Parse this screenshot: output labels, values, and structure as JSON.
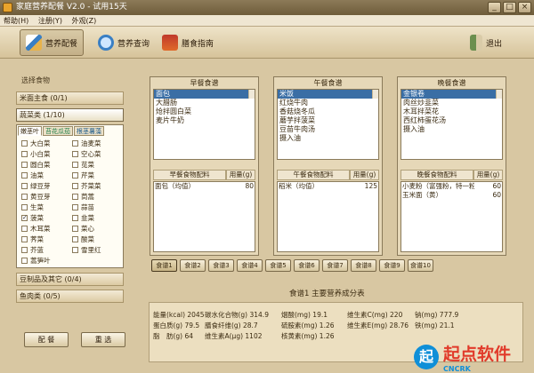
{
  "window": {
    "title": "家庭营养配餐 V2.0 - 试用15天",
    "min": "_",
    "max": "□",
    "close": "×"
  },
  "menu": [
    "帮助(H)",
    "注册(Y)",
    "外观(Z)"
  ],
  "toolbar": {
    "items": [
      "营养配餐",
      "营养查询",
      "膳食指南"
    ],
    "exit": "退出"
  },
  "left": {
    "select_label": "选择食物",
    "categories": [
      "米面主食 (0/1)",
      "蔬菜类 (1/10)",
      "豆制品及其它 (0/4)",
      "鱼肉类 (0/5)"
    ],
    "veg_tabs": [
      "嫩茎叶",
      "苔花瓜茄",
      "根茎薯藻"
    ],
    "veg_left": [
      {
        "name": "大白菜",
        "checked": false
      },
      {
        "name": "小白菜",
        "checked": false
      },
      {
        "name": "圆白菜",
        "checked": false
      },
      {
        "name": "油菜",
        "checked": false
      },
      {
        "name": "绿豆芽",
        "checked": false
      },
      {
        "name": "黄豆芽",
        "checked": false
      },
      {
        "name": "生菜",
        "checked": false
      },
      {
        "name": "菠菜",
        "checked": true
      },
      {
        "name": "木耳菜",
        "checked": false
      },
      {
        "name": "荠菜",
        "checked": false
      },
      {
        "name": "芥蓝",
        "checked": false
      },
      {
        "name": "蒿笋叶",
        "checked": false
      }
    ],
    "veg_right": [
      {
        "name": "油麦菜",
        "checked": false
      },
      {
        "name": "空心菜",
        "checked": false
      },
      {
        "name": "苋菜",
        "checked": false
      },
      {
        "name": "芹菜",
        "checked": false
      },
      {
        "name": "芥菜菜",
        "checked": false
      },
      {
        "name": "茼蒿",
        "checked": false
      },
      {
        "name": "蒜苗",
        "checked": false
      },
      {
        "name": "韭菜",
        "checked": false
      },
      {
        "name": "菜心",
        "checked": false
      },
      {
        "name": "酸菜",
        "checked": false
      },
      {
        "name": "雪里红",
        "checked": false
      }
    ],
    "btn_pei": "配 餐",
    "btn_reselect": "重 选"
  },
  "meals": [
    {
      "title": "早餐食谱",
      "items": [
        "面包",
        "大腊肠",
        "炝拌圆白菜",
        "麦片牛奶"
      ],
      "selected": 0,
      "col_food": "早餐食物配料",
      "col_qty": "用量(g)",
      "rows": [
        [
          "面包（均值）",
          "80"
        ]
      ]
    },
    {
      "title": "午餐食谱",
      "items": [
        "米饭",
        "红烧牛肉",
        "香菇烧冬瓜",
        "蘑芋拌菠菜",
        "豆苗牛肉汤",
        "摄入油"
      ],
      "selected": 0,
      "col_food": "午餐食物配料",
      "col_qty": "用量(g)",
      "rows": [
        [
          "稻米（均值）",
          "125"
        ]
      ]
    },
    {
      "title": "晚餐食谱",
      "items": [
        "金银卷",
        "肉丝炒韭菜",
        "木耳拌菜花",
        "西红柿蛋花汤",
        "摄入油"
      ],
      "selected": 0,
      "col_food": "晚餐食物配料",
      "col_qty": "用量(g)",
      "rows": [
        [
          "小麦粉（富强粉，特一粉）",
          "60"
        ],
        [
          "玉米面（黄）",
          "60"
        ]
      ]
    }
  ],
  "meal_tabs": [
    "食谱1",
    "食谱2",
    "食谱3",
    "食谱4",
    "食谱5",
    "食谱6",
    "食谱7",
    "食谱8",
    "食谱9",
    "食谱10"
  ],
  "nutrition": {
    "title": "食谱1 主要营养成分表",
    "rows": [
      [
        "能量(kcal) 2045",
        "碳水化合物(g) 314.9",
        "烟酸(mg) 19.1",
        "维生素C(mg) 220",
        "钠(mg) 777.9"
      ],
      [
        "蛋白质(g) 79.5",
        "膳食纤维(g) 28.7",
        "硫胺素(mg) 1.26",
        "维生素E(mg) 28.76",
        "铁(mg) 21.1"
      ],
      [
        "脂　肪(g) 64",
        "维生素A(μg) 1102",
        "核黄素(mg) 1.26",
        "",
        ""
      ]
    ]
  },
  "watermark": {
    "logo": "起",
    "text": "起点软件",
    "sub": "CNCRK"
  }
}
